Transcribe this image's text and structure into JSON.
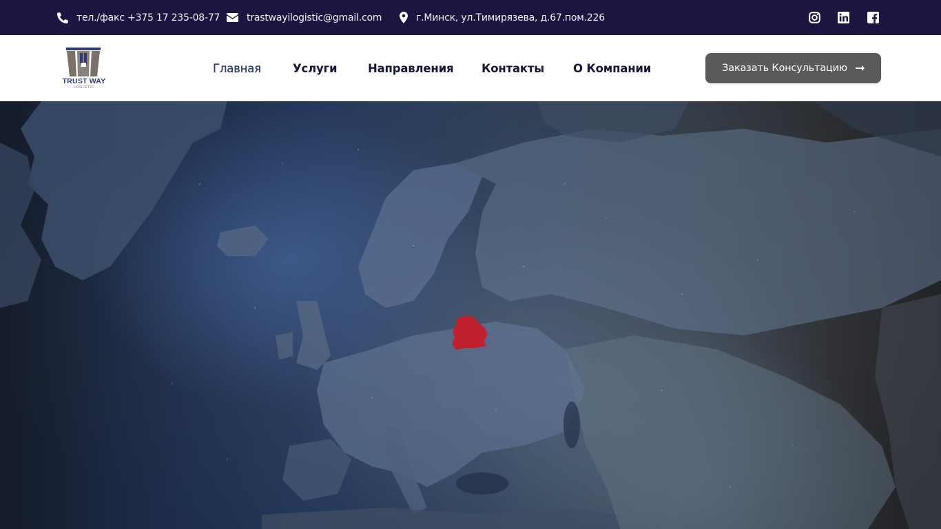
{
  "topbar": {
    "phone": "тел./факс +375 17 235-08-77",
    "email": "trastwayilogistic@gmail.com",
    "address": "г.Минск, ул.Тимирязева, д.67.пом.226",
    "icons": {
      "phone": "phone-icon",
      "email": "envelope-icon",
      "address": "map-marker-icon",
      "social": [
        "instagram-icon",
        "linkedin-icon",
        "facebook-icon"
      ]
    }
  },
  "header": {
    "logo": {
      "title": "TRUST WAY",
      "subtitle": "LOGISTIC"
    },
    "nav": [
      {
        "label": "Главная",
        "active": true
      },
      {
        "label": "Услуги",
        "active": false
      },
      {
        "label": "Направления",
        "active": false
      },
      {
        "label": "Контакты",
        "active": false
      },
      {
        "label": "О Компании",
        "active": false
      }
    ],
    "cta_label": "Заказать Консультацию",
    "cta_icon": "arrow-right-icon"
  },
  "hero": {
    "highlight_country_icon": "belarus-highlight",
    "colors": {
      "topbar": "#1a1640",
      "cta": "#5a5a5a",
      "highlight": "#c0212e"
    }
  }
}
